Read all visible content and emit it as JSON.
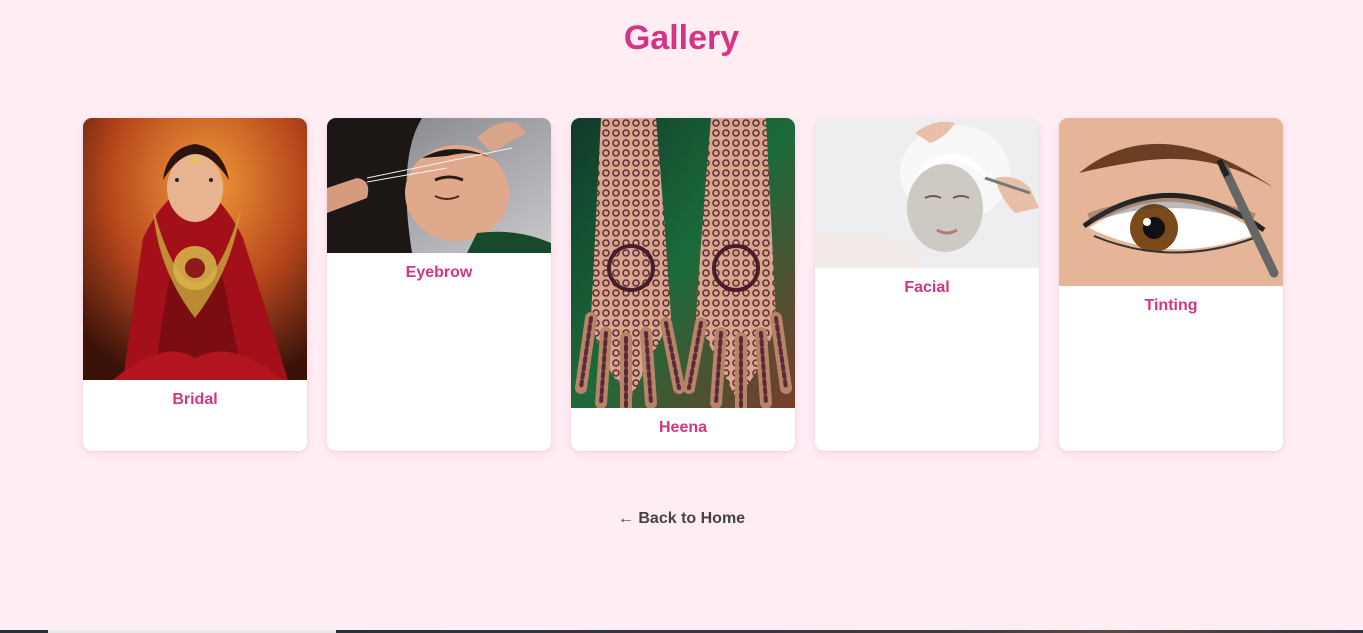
{
  "page": {
    "title": "Gallery",
    "back_link": "← Back to Home"
  },
  "gallery": {
    "items": [
      {
        "label": "Bridal",
        "image": "bridal-photo"
      },
      {
        "label": "Eyebrow",
        "image": "eyebrow-threading-photo"
      },
      {
        "label": "Heena",
        "image": "henna-hands-photo"
      },
      {
        "label": "Facial",
        "image": "facial-mask-photo"
      },
      {
        "label": "Tinting",
        "image": "eyebrow-tinting-photo"
      }
    ]
  },
  "colors": {
    "background": "#ffedf4",
    "accent": "#d63384",
    "link": "#444444"
  }
}
